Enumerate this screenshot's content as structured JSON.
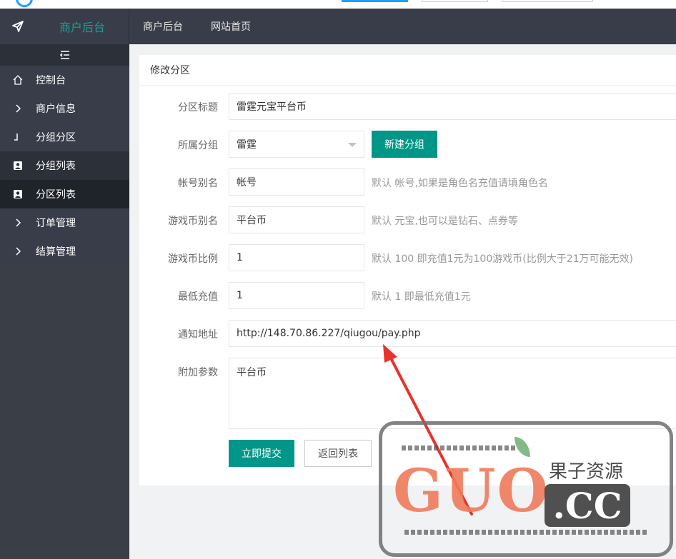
{
  "header": {
    "brand": "商户后台",
    "nav": [
      "商户后台",
      "网站首页"
    ]
  },
  "sidebar": {
    "items": [
      {
        "label": "控制台",
        "icon": "home-icon"
      },
      {
        "label": "商户信息",
        "icon": "chevron-right-icon"
      },
      {
        "label": "分组分区",
        "icon": "corner-icon"
      },
      {
        "label": "分组列表",
        "icon": "user-card-icon"
      },
      {
        "label": "分区列表",
        "icon": "user-card-icon"
      },
      {
        "label": "订单管理",
        "icon": "chevron-right-icon"
      },
      {
        "label": "结算管理",
        "icon": "chevron-right-icon"
      }
    ]
  },
  "card": {
    "title": "修改分区"
  },
  "form": {
    "title_label": "分区标题",
    "title_value": "雷霆元宝平台币",
    "group_label": "所属分组",
    "group_value": "雷霆",
    "new_group_button": "新建分组",
    "account_alias_label": "帐号别名",
    "account_alias_value": "帐号",
    "account_alias_hint": "默认 帐号,如果是角色名充值请填角色名",
    "currency_alias_label": "游戏币别名",
    "currency_alias_value": "平台币",
    "currency_alias_hint": "默认 元宝,也可以是钻石、点券等",
    "ratio_label": "游戏币比例",
    "ratio_value": "1",
    "ratio_hint": "默认 100 即充值1元为100游戏币(比例大于21万可能无效)",
    "min_label": "最低充值",
    "min_value": "1",
    "min_hint": "默认 1 即最低充值1元",
    "notify_label": "通知地址",
    "notify_value": "http://148.70.86.227/qiugou/pay.php",
    "extra_label": "附加参数",
    "extra_value": "平台币",
    "submit_button": "立即提交",
    "back_button": "返回列表"
  },
  "watermark": {
    "latin": "GUO",
    "cn": "果子资源",
    "suffix": ".CC"
  },
  "colors": {
    "header_bg": "#393d49",
    "brand": "#1aa094",
    "primary": "#009688",
    "annotation": "#e8322c"
  }
}
